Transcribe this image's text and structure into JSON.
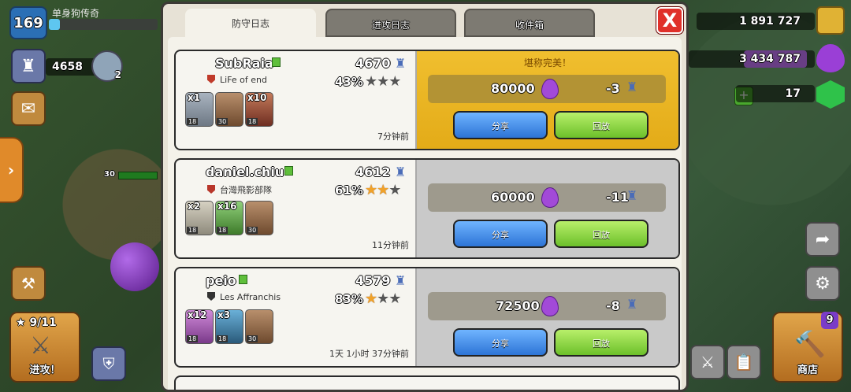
{
  "hud": {
    "level": "169",
    "player_name": "单身狗传奇",
    "xp_progress": 0.1,
    "trophies": "4658",
    "league_level": "2",
    "hp_num": "30",
    "attack_count": "9/11",
    "attack_label": "进攻！",
    "gold": "1 891 727",
    "elixir": "3 434 787",
    "gems": "17",
    "shop_label": "商店",
    "shop_badge": "9"
  },
  "panel": {
    "tabs": [
      "防守日志",
      "进攻日志",
      "收件箱"
    ],
    "active_tab": 0,
    "close_label": "X"
  },
  "log": [
    {
      "name": "SubRaia",
      "clan": "LiFe of end",
      "trophies": "4670",
      "percent": "43%",
      "stars": 0,
      "time": "7分钟前",
      "perfect_label": "堪称完美！",
      "loot": "80000",
      "trophy_change": "-3",
      "share": "分享",
      "replay": "回放",
      "troops": [
        {
          "count": "x1",
          "level": "18"
        },
        {
          "count": "",
          "level": "30"
        },
        {
          "count": "x10",
          "level": "18"
        }
      ]
    },
    {
      "name": "daniel.chiu",
      "clan": "台灣飛影部隊",
      "trophies": "4612",
      "percent": "61%",
      "stars": 2,
      "time": "11分钟前",
      "perfect_label": "",
      "loot": "60000",
      "trophy_change": "-11",
      "share": "分享",
      "replay": "回放",
      "troops": [
        {
          "count": "x2",
          "level": "18"
        },
        {
          "count": "x16",
          "level": "18"
        },
        {
          "count": "",
          "level": "30"
        }
      ]
    },
    {
      "name": "peio",
      "clan": "Les Affranchis",
      "trophies": "4579",
      "percent": "83%",
      "stars": 1,
      "time": "1天 1小时 37分钟前",
      "perfect_label": "",
      "loot": "72500",
      "trophy_change": "-8",
      "share": "分享",
      "replay": "回放",
      "troops": [
        {
          "count": "x12",
          "level": "18"
        },
        {
          "count": "x3",
          "level": "18"
        },
        {
          "count": "",
          "level": "30"
        }
      ]
    }
  ],
  "colors": {
    "gold_card": "#e3ab18",
    "grey_card": "#c9c9c9",
    "share_blue": "#2d74d6",
    "replay_green": "#6cc02a",
    "close_red": "#e0302a"
  }
}
